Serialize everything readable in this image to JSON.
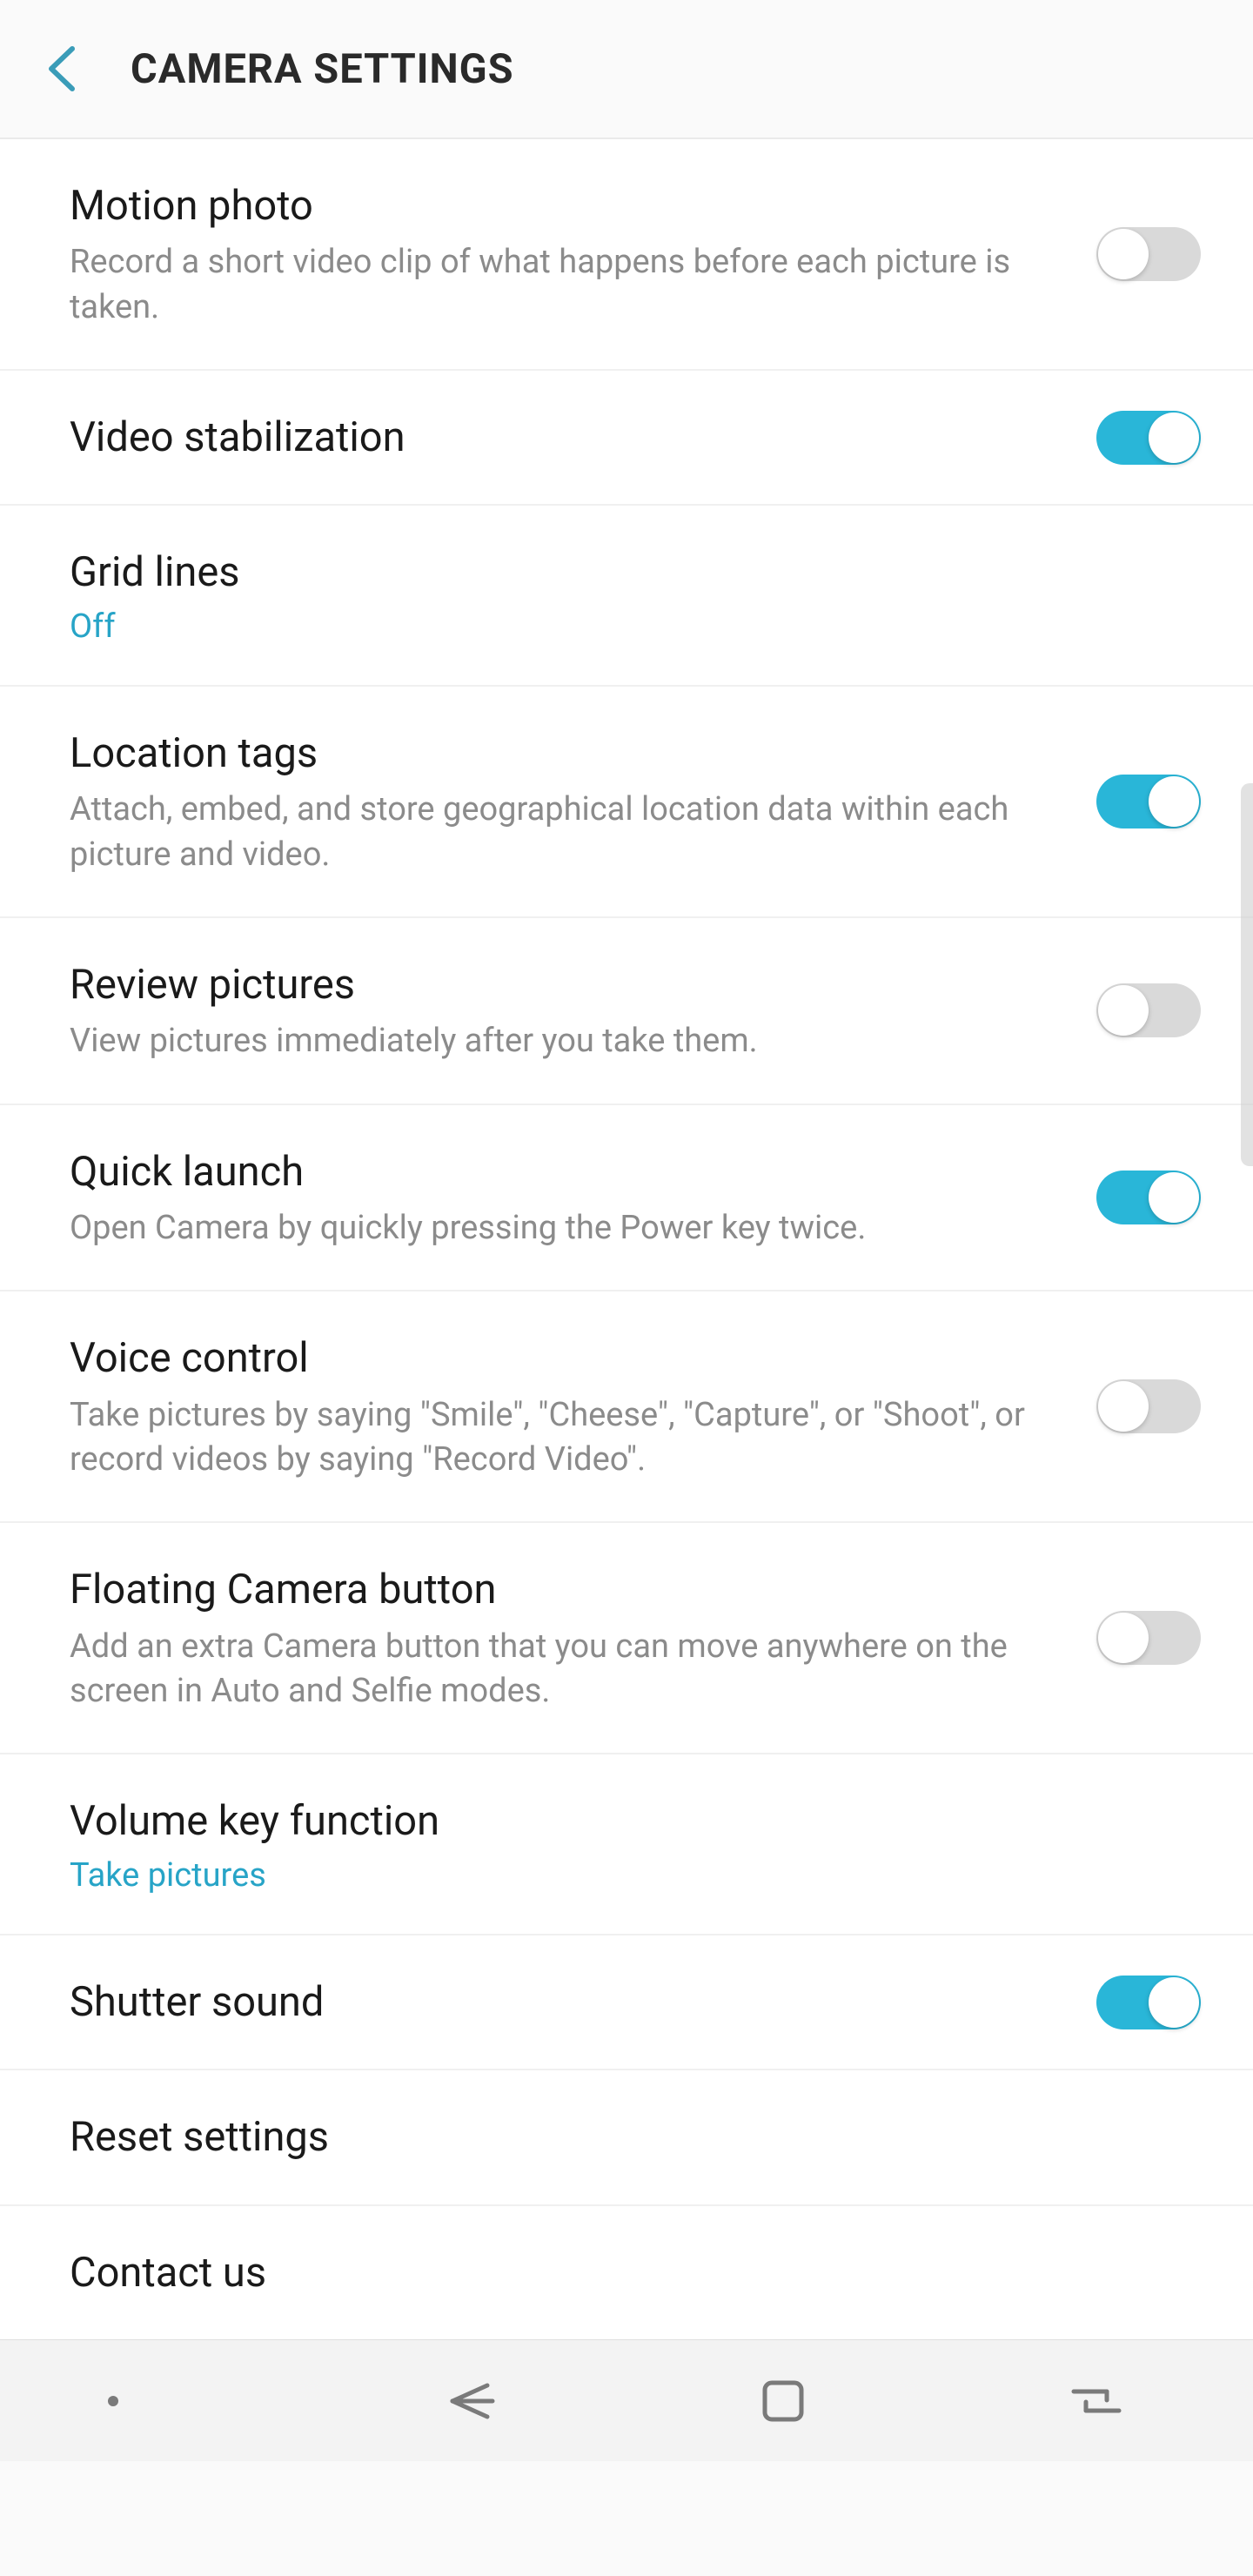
{
  "header": {
    "title": "CAMERA SETTINGS"
  },
  "items": [
    {
      "title": "Motion photo",
      "desc": "Record a short video clip of what happens before each picture is taken.",
      "type": "toggle",
      "on": false
    },
    {
      "title": "Video stabilization",
      "type": "toggle",
      "on": true
    },
    {
      "title": "Grid lines",
      "value": "Off",
      "type": "value"
    },
    {
      "title": "Location tags",
      "desc": "Attach, embed, and store geographical location data within each picture and video.",
      "type": "toggle",
      "on": true
    },
    {
      "title": "Review pictures",
      "desc": "View pictures immediately after you take them.",
      "type": "toggle",
      "on": false
    },
    {
      "title": "Quick launch",
      "desc": "Open Camera by quickly pressing the Power key twice.",
      "type": "toggle",
      "on": true
    },
    {
      "title": "Voice control",
      "desc": "Take pictures by saying \"Smile\", \"Cheese\", \"Capture\", or \"Shoot\", or record videos by saying \"Record Video\".",
      "type": "toggle",
      "on": false
    },
    {
      "title": "Floating Camera button",
      "desc": "Add an extra Camera button that you can move anywhere on the screen in Auto and Selfie modes.",
      "type": "toggle",
      "on": false
    },
    {
      "title": "Volume key function",
      "value": "Take pictures",
      "type": "value"
    },
    {
      "title": "Shutter sound",
      "type": "toggle",
      "on": true
    },
    {
      "title": "Reset settings",
      "type": "link"
    },
    {
      "title": "Contact us",
      "type": "link"
    }
  ],
  "colors": {
    "accent": "#29b6d8",
    "value_text": "#27a4c7"
  }
}
